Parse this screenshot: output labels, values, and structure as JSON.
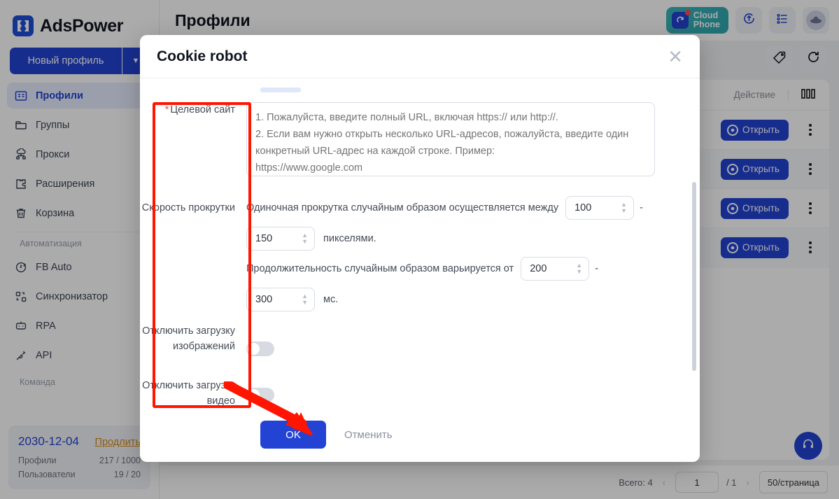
{
  "app": {
    "brand": "AdsPower",
    "page_title": "Профили"
  },
  "sidebar": {
    "new_profile_label": "Новый профиль",
    "items": [
      {
        "label": "Профили",
        "icon": "profiles-icon",
        "active": true
      },
      {
        "label": "Группы",
        "icon": "folder-icon",
        "active": false
      },
      {
        "label": "Прокси",
        "icon": "proxy-icon",
        "active": false
      },
      {
        "label": "Расширения",
        "icon": "extensions-icon",
        "active": false
      },
      {
        "label": "Корзина",
        "icon": "trash-icon",
        "active": false
      }
    ],
    "group_automation_label": "Автоматизация",
    "automation_items": [
      {
        "label": "FB Auto",
        "icon": "facebook-auto-icon"
      },
      {
        "label": "Синхронизатор",
        "icon": "synchronizer-icon"
      },
      {
        "label": "RPA",
        "icon": "rpa-robot-icon"
      },
      {
        "label": "API",
        "icon": "api-plug-icon"
      }
    ],
    "group_team_label": "Команда",
    "plan": {
      "date": "2030-12-04",
      "renew_label": "Продлить",
      "profiles_label": "Профили",
      "profiles_value": "217 / 1000",
      "users_label": "Пользователи",
      "users_value": "19 / 20"
    }
  },
  "topbar": {
    "cloud_phone_line1": "Cloud",
    "cloud_phone_line2": "Phone",
    "sync_icon": "sync-upload-icon",
    "list_icon": "list-settings-icon",
    "avatar_icon": "avatar-icon",
    "filter_icon": "filter-sliders-icon",
    "tag_icon": "tag-icon",
    "refresh_icon": "refresh-icon"
  },
  "table": {
    "action_header": "Действие",
    "columns_icon": "columns-settings-icon",
    "rows": [
      {
        "open_label": "Открыть"
      },
      {
        "open_label": "Открыть"
      },
      {
        "open_label": "Открыть"
      },
      {
        "open_label": "Открыть"
      }
    ]
  },
  "footer": {
    "total_label": "Всего: 4",
    "prev_icon": "chevron-left-icon",
    "next_icon": "chevron-right-icon",
    "page_value": "1",
    "page_total": "/ 1",
    "page_size": "50/страница",
    "help_icon": "headset-support-icon"
  },
  "modal": {
    "title": "Cookie robot",
    "close_icon": "close-icon",
    "fields": {
      "target_site": {
        "label": "Целевой сайт",
        "required": true,
        "placeholder": "1. Пожалуйста, введите полный URL, включая https:// или http://.\n2. Если вам нужно открыть несколько URL-адресов, пожалуйста, введите один конкретный URL-адрес на каждой строке. Пример:\nhttps://www.google.com\nhttps://facebook.com",
        "value": ""
      },
      "scroll_speed": {
        "label": "Скорость прокрутки",
        "text_before": "Одиночная прокрутка случайным образом осуществляется между",
        "min_value": "100",
        "separator": "-",
        "max_value": "150",
        "text_after": "пикселями."
      },
      "duration": {
        "text_before": "Продолжительность случайным образом варьируется от",
        "min_value": "200",
        "separator": "-",
        "max_value": "300",
        "text_after": "мс."
      },
      "disable_images": {
        "label": "Отключить загрузку изображений",
        "enabled": false
      },
      "disable_video": {
        "label": "Отключить загрузку видео",
        "enabled": false
      }
    },
    "ok_label": "OK",
    "cancel_label": "Отменить"
  },
  "annotations": {
    "highlight_box_color": "#ff1500",
    "arrow_color": "#ff1500"
  }
}
